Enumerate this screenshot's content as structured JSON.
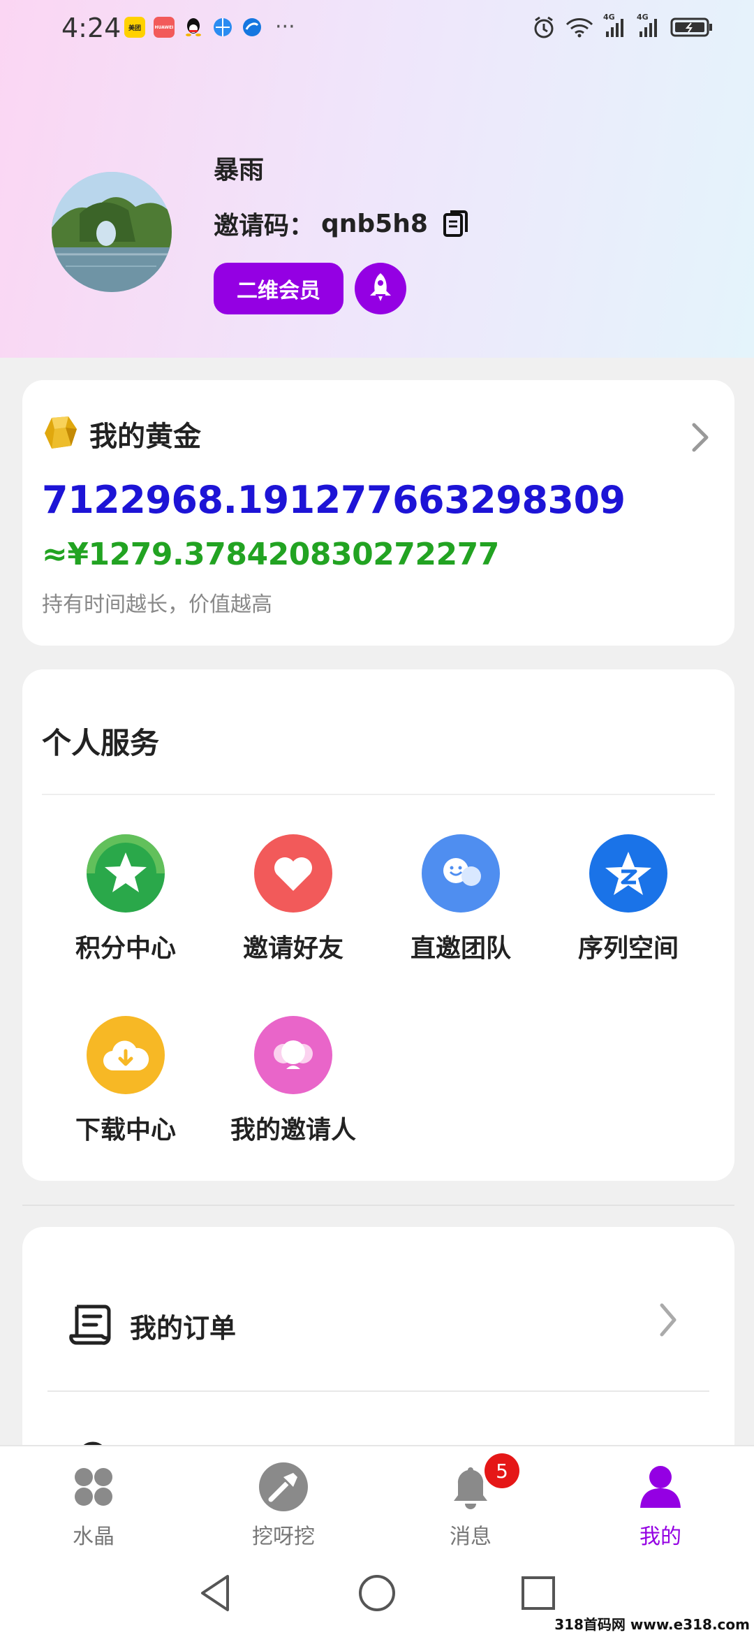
{
  "status_bar": {
    "time": "4:24",
    "apps": [
      "美团",
      "HUAWEI",
      "qq",
      "browser",
      "browser2"
    ],
    "more": "···",
    "network_1": "4G",
    "network_2": "4G"
  },
  "profile": {
    "username": "暴雨",
    "invite_label": "邀请码：",
    "invite_code": "qnb5h8",
    "member_label": "二维会员"
  },
  "gold": {
    "title": "我的黄金",
    "amount": "7122968.191277663298309",
    "cny_value": "≈¥1279.378420830272277",
    "note": "持有时间越长，价值越高"
  },
  "services": {
    "title": "个人服务",
    "items": [
      {
        "label": "积分中心",
        "icon": "star-icon",
        "color": "#2aa84a"
      },
      {
        "label": "邀请好友",
        "icon": "heart-icon",
        "color": "#f25a5a"
      },
      {
        "label": "直邀团队",
        "icon": "team-icon",
        "color": "#4f8ef0"
      },
      {
        "label": "序列空间",
        "icon": "qzone-star-icon",
        "color": "#1a73e8"
      },
      {
        "label": "下载中心",
        "icon": "cloud-download-icon",
        "color": "#f7b825"
      },
      {
        "label": "我的邀请人",
        "icon": "inviter-icon",
        "color": "#e965c9"
      }
    ]
  },
  "menu": {
    "orders_label": "我的订单"
  },
  "tabbar": {
    "tabs": [
      {
        "label": "水晶",
        "icon": "clover-icon",
        "active": false
      },
      {
        "label": "挖呀挖",
        "icon": "shovel-icon",
        "active": false
      },
      {
        "label": "消息",
        "icon": "bell-icon",
        "active": false,
        "badge": "5"
      },
      {
        "label": "我的",
        "icon": "person-icon",
        "active": true
      }
    ],
    "active_color": "#9400e3"
  },
  "watermark": "318首码网 www.e318.com"
}
